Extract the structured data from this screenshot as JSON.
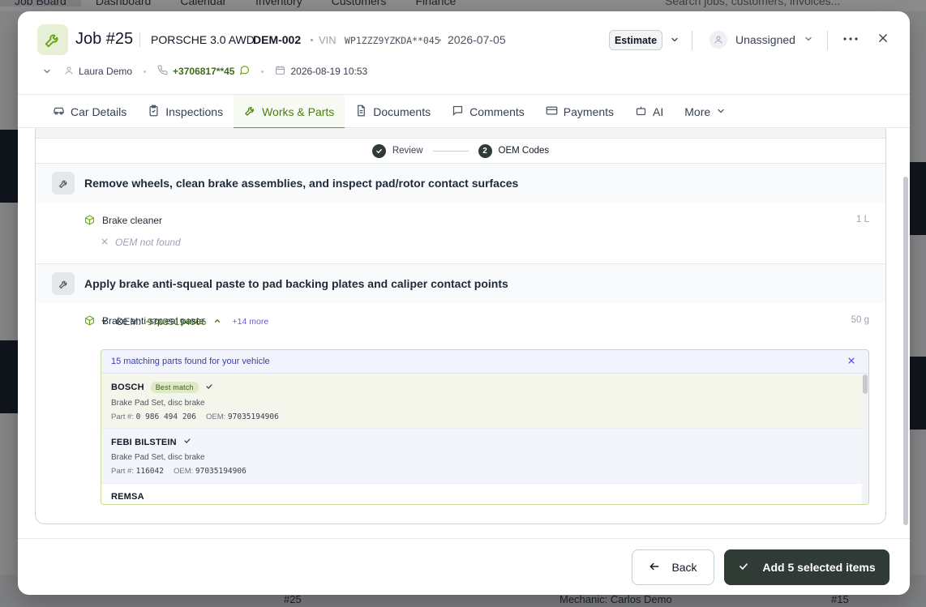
{
  "bg": {
    "nav": [
      "Job Board",
      "Dashboard",
      "Calendar",
      "Inventory",
      "Customers",
      "Finance"
    ],
    "search_placeholder": "Search jobs, customers, invoices...",
    "bottom_cells": [
      "#25",
      "Mechanic: Carlos Demo",
      "#15"
    ]
  },
  "header": {
    "job_title": "Job #25",
    "car_model": "PORSCHE 3.0 AWD",
    "plate": "DEM-002",
    "vin_label": "VIN",
    "vin": "WP1ZZZ9YZKDA**045",
    "date": "2026-07-05",
    "status_button": "Estimate",
    "assignee": "Unassigned",
    "customer_name": "Laura Demo",
    "phone": "+3706817**45",
    "appointment": "2026-08-19 10:53"
  },
  "tabs": [
    {
      "label": "Car Details",
      "icon": "car-icon"
    },
    {
      "label": "Inspections",
      "icon": "clipboard-icon"
    },
    {
      "label": "Works & Parts",
      "icon": "wrench-icon",
      "active": true
    },
    {
      "label": "Documents",
      "icon": "document-icon"
    },
    {
      "label": "Comments",
      "icon": "comment-icon"
    },
    {
      "label": "Payments",
      "icon": "card-icon"
    },
    {
      "label": "AI",
      "icon": "robot-icon"
    },
    {
      "label": "More",
      "icon": "chevron-down-icon"
    }
  ],
  "stepper": {
    "step1": "Review",
    "step2_number": "2",
    "step2": "OEM Codes"
  },
  "tasks": [
    {
      "title": "Remove wheels, clean brake assemblies, and inspect pad/rotor contact surfaces",
      "part": {
        "name": "Brake cleaner",
        "qty": "1 L",
        "oem_status": "OEM not found"
      }
    },
    {
      "title": "Apply brake anti-squeal paste to pad backing plates and caliper contact points",
      "part": {
        "name": "Brake anti-squeal paste",
        "qty": "50 g",
        "oem_label": "OEM:",
        "oem_code": "97035194906",
        "more": "+14 more"
      }
    }
  ],
  "matches": {
    "header": "15 matching parts found for your vehicle",
    "best_badge": "Best match",
    "partnum_label": "Part #:",
    "oem_label": "OEM:",
    "items": [
      {
        "brand": "BOSCH",
        "desc": "Brake Pad Set, disc brake",
        "part_no": "0 986 494 206",
        "oem": "97035194906"
      },
      {
        "brand": "FEBI BILSTEIN",
        "desc": "Brake Pad Set, disc brake",
        "part_no": "116042",
        "oem": "97035194906"
      },
      {
        "brand": "REMSA",
        "desc": "",
        "part_no": "",
        "oem": ""
      }
    ]
  },
  "footer": {
    "back": "Back",
    "add": "Add 5 selected items"
  },
  "colors": {
    "accent": "#65a30d",
    "primary_dark": "#2f3b34",
    "link_purple": "#6d5bd0"
  }
}
